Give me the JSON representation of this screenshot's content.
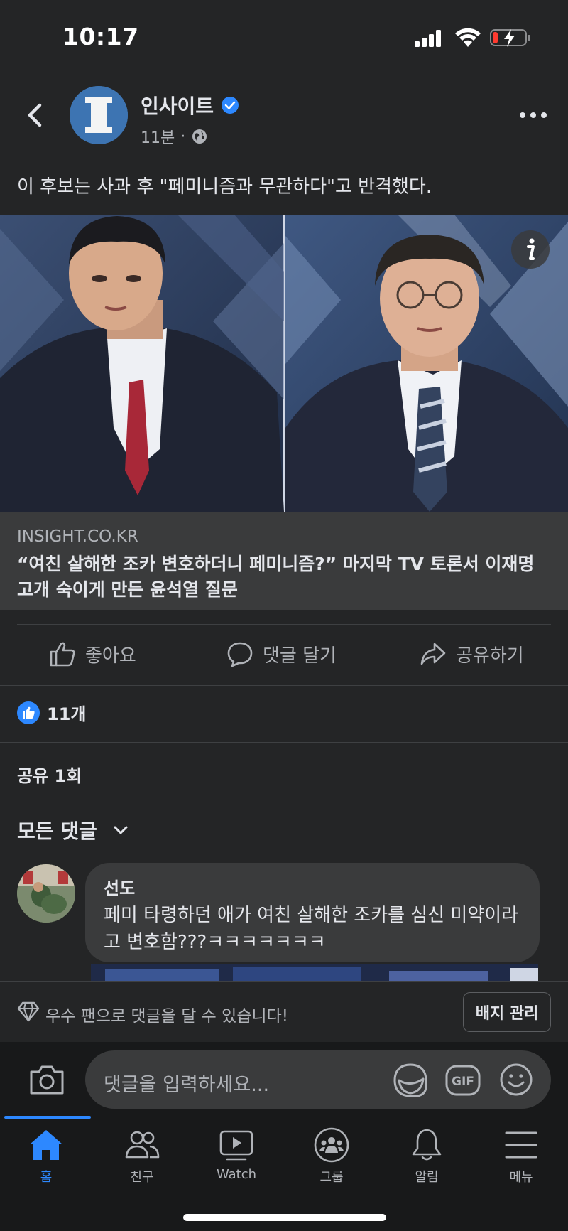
{
  "status_bar": {
    "time": "10:17"
  },
  "post": {
    "page_name": "인사이트",
    "time_ago": "11분",
    "separator": "·",
    "text": "이 후보는 사과 후 \"페미니즘과 무관하다\"고 반격했다.",
    "link_domain": "INSIGHT.CO.KR",
    "link_title": "“여친 살해한 조카 변호하더니 페미니즘?” 마지막 TV 토론서 이재명 고개 숙이게 만든 윤석열 질문"
  },
  "actions": {
    "like": "좋아요",
    "comment": "댓글 달기",
    "share": "공유하기"
  },
  "reactions": {
    "count": "11개"
  },
  "shares": {
    "label": "공유 1회"
  },
  "comments": {
    "filter_label": "모든 댓글",
    "items": [
      {
        "author": "선도",
        "body": "페미 타령하던 애가 여친 살해한 조카를 심신 미약이라고 변호함???ㅋㅋㅋㅋㅋㅋㅋ"
      }
    ]
  },
  "fan_bar": {
    "text": "우수 팬으로 댓글을 달 수 있습니다!",
    "button": "배지 관리"
  },
  "comment_input": {
    "placeholder": "댓글을 입력하세요..."
  },
  "tabs": [
    {
      "label": "홈",
      "icon": "home-icon",
      "active": true
    },
    {
      "label": "친구",
      "icon": "friends-icon",
      "active": false
    },
    {
      "label": "Watch",
      "icon": "watch-icon",
      "active": false
    },
    {
      "label": "그룹",
      "icon": "groups-icon",
      "active": false
    },
    {
      "label": "알림",
      "icon": "bell-icon",
      "active": false
    },
    {
      "label": "메뉴",
      "icon": "menu-icon",
      "active": false
    }
  ],
  "colors": {
    "accent": "#2d88ff",
    "background": "#242526",
    "surface": "#3a3b3c",
    "text": "#e4e6eb",
    "muted": "#b0b3b8"
  }
}
